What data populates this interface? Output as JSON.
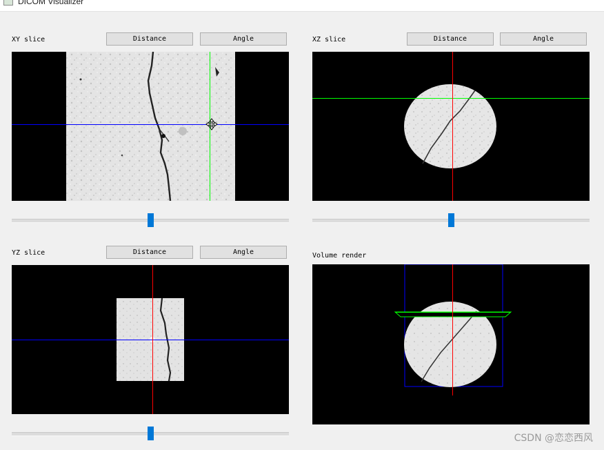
{
  "window": {
    "title": "DICOM Visualizer"
  },
  "panels": {
    "xy": {
      "label": "XY slice",
      "distance": "Distance",
      "angle": "Angle"
    },
    "xz": {
      "label": "XZ slice",
      "distance": "Distance",
      "angle": "Angle"
    },
    "yz": {
      "label": "YZ slice",
      "distance": "Distance",
      "angle": "Angle"
    },
    "volume": {
      "label": "Volume render"
    }
  },
  "sliders": {
    "xy": {
      "level": 0.5
    },
    "xz": {
      "level": 0.5
    },
    "yz": {
      "level": 0.5
    }
  },
  "colors": {
    "crosshair_blue": "#0000ff",
    "crosshair_green": "#00ff00",
    "crosshair_red": "#ff0000",
    "slider_handle": "#0078d7"
  },
  "watermark": "CSDN @恋恋西风"
}
